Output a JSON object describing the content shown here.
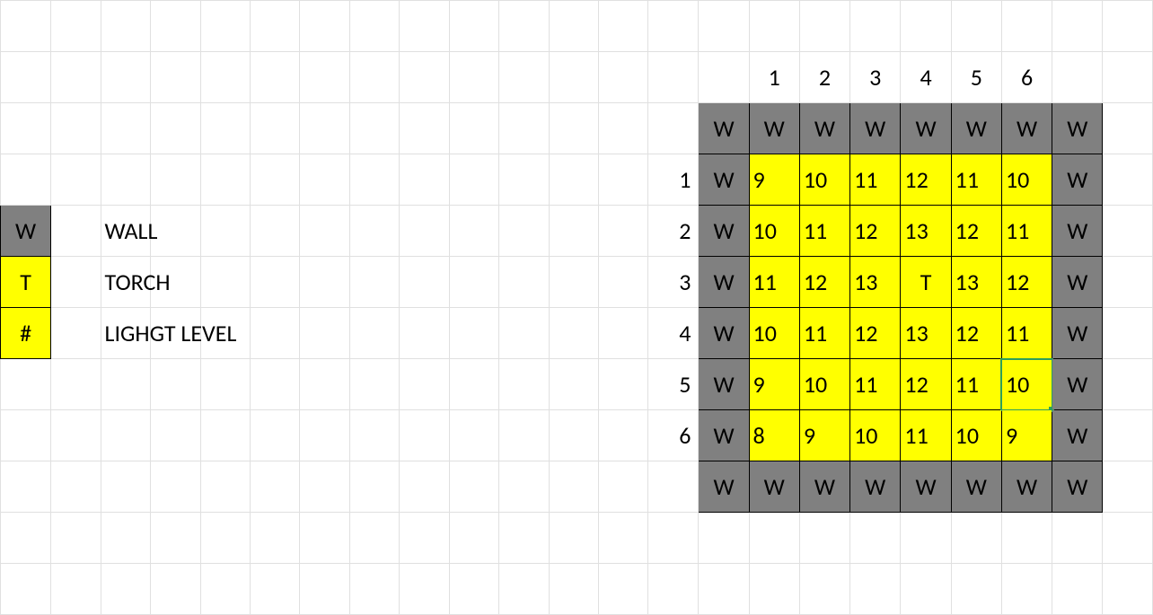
{
  "legend": {
    "wall": {
      "symbol": "W",
      "label": "WALL"
    },
    "torch": {
      "symbol": "T",
      "label": "TORCH"
    },
    "light": {
      "symbol": "#",
      "label": "LIGHGT LEVEL"
    }
  },
  "grid": {
    "col_headers": [
      "1",
      "2",
      "3",
      "4",
      "5",
      "6"
    ],
    "row_headers": [
      "1",
      "2",
      "3",
      "4",
      "5",
      "6"
    ],
    "wall_symbol": "W",
    "torch_symbol": "T",
    "rows": [
      [
        "9",
        "10",
        "11",
        "12",
        "11",
        "10"
      ],
      [
        "10",
        "11",
        "12",
        "13",
        "12",
        "11"
      ],
      [
        "11",
        "12",
        "13",
        "T",
        "13",
        "12"
      ],
      [
        "10",
        "11",
        "12",
        "13",
        "12",
        "11"
      ],
      [
        "9",
        "10",
        "11",
        "12",
        "11",
        "10"
      ],
      [
        "8",
        "9",
        "10",
        "11",
        "10",
        "9"
      ]
    ],
    "selected": {
      "row": 5,
      "col": 6
    }
  },
  "colors": {
    "wall": "#808080",
    "torch": "#ffff00",
    "light": "#ffff00",
    "gridline": "#e0e0e0",
    "select": "#2e9e5b"
  }
}
